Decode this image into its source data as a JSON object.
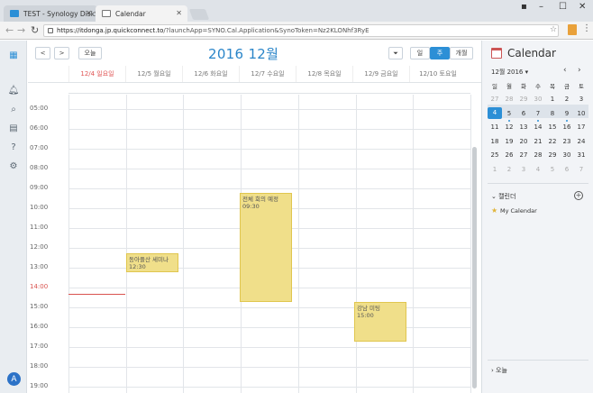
{
  "browser": {
    "tabs": [
      {
        "label": "TEST - Synology DiskSt",
        "favicon_color": "#2c8fd6"
      },
      {
        "label": "Calendar",
        "favicon_color": "#777777"
      }
    ],
    "url_host": "https://itdonga.jp.quickconnect.to",
    "url_rest": "/?launchApp=SYNO.Cal.Application&SynoToken=Nz2KLONhf3RyE"
  },
  "toolbar": {
    "prev": "<",
    "next": ">",
    "today": "오늘",
    "title": "2016 12월",
    "filter_icon": "funnel-icon",
    "view_day": "일",
    "view_week": "주",
    "view_month": "개월",
    "accent": "#2a85c9"
  },
  "days": [
    "12/4 일요일",
    "12/5 월요일",
    "12/6 화요일",
    "12/7 수요일",
    "12/8 목요일",
    "12/9 금요일",
    "12/10 토요일"
  ],
  "hours": [
    "05:00",
    "06:00",
    "07:00",
    "08:00",
    "09:00",
    "10:00",
    "11:00",
    "12:00",
    "13:00",
    "14:00",
    "15:00",
    "16:00",
    "17:00",
    "18:00",
    "19:00"
  ],
  "events": [
    {
      "title": "동아플산 세미나",
      "time": "12:30",
      "day": "12/5 월요일",
      "start": "12:30",
      "end": "13:30"
    },
    {
      "title": "전체 회의 예정",
      "time": "09:30",
      "day": "12/7 수요일",
      "start": "09:30",
      "end": "15:00"
    },
    {
      "title": "강남 미팅",
      "time": "15:00",
      "day": "12/9 금요일",
      "start": "15:00",
      "end": "17:00"
    }
  ],
  "current_time": "14:00",
  "event_color": "#f0df8a",
  "sidebar": {
    "title": "Calendar",
    "month_label": "12월 2016",
    "weekdays": [
      "일",
      "월",
      "화",
      "수",
      "목",
      "금",
      "토"
    ],
    "weeks": [
      [
        "27",
        "28",
        "29",
        "30",
        "1",
        "2",
        "3"
      ],
      [
        "4",
        "5",
        "6",
        "7",
        "8",
        "9",
        "10"
      ],
      [
        "11",
        "12",
        "13",
        "14",
        "15",
        "16",
        "17"
      ],
      [
        "18",
        "19",
        "20",
        "21",
        "22",
        "23",
        "24"
      ],
      [
        "25",
        "26",
        "27",
        "28",
        "29",
        "30",
        "31"
      ],
      [
        "1",
        "2",
        "3",
        "4",
        "5",
        "6",
        "7"
      ]
    ],
    "calendars_label": "캘린더",
    "my_calendar": "My Calendar",
    "today_section": "오늘"
  },
  "user_initial": "A"
}
